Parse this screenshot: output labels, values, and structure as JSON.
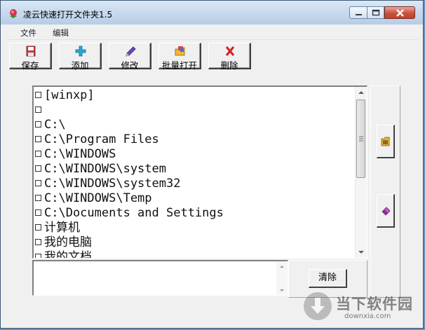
{
  "window": {
    "title": "凌云快速打开文件夹1.5"
  },
  "menu": {
    "items": [
      "文件",
      "编辑"
    ]
  },
  "toolbar": {
    "buttons": [
      {
        "label": "保存",
        "icon": "floppy-icon"
      },
      {
        "label": "添加",
        "icon": "plus-icon"
      },
      {
        "label": "修改",
        "icon": "pencil-icon"
      },
      {
        "label": "批量打开",
        "icon": "open-folder-icon"
      },
      {
        "label": "删除",
        "icon": "delete-x-icon"
      }
    ]
  },
  "folder_list": {
    "items": [
      "[winxp]",
      "",
      "C:\\",
      "C:\\Program Files",
      "C:\\WINDOWS",
      "C:\\WINDOWS\\system",
      "C:\\WINDOWS\\system32",
      "C:\\WINDOWS\\Temp",
      "C:\\Documents and Settings",
      "计算机",
      "我的电脑",
      "我的文档"
    ]
  },
  "side_buttons": {
    "icons": [
      "folder-open-icon",
      "eraser-icon"
    ]
  },
  "input": {
    "value": ""
  },
  "clear_button": {
    "label": "清除"
  },
  "watermark": {
    "text": "当下软件园",
    "url": "downxia.com"
  },
  "colors": {
    "title_gradient": "#c7d9ee",
    "close_red": "#c7523d",
    "face": "#f0f0f0"
  }
}
